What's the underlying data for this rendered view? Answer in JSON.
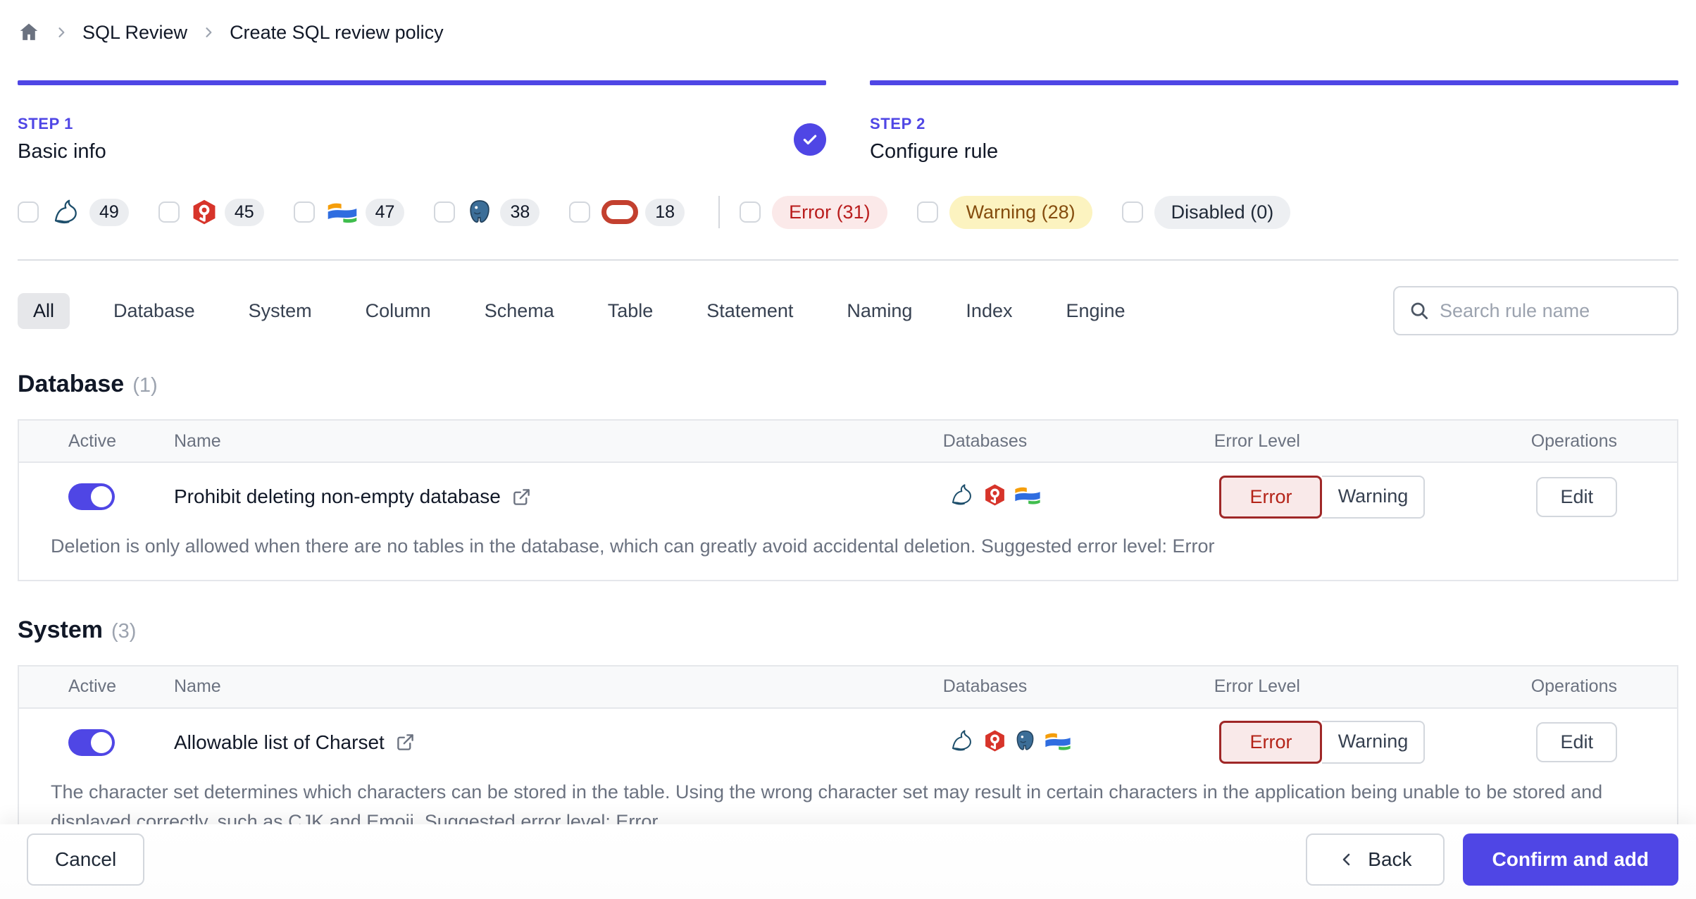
{
  "breadcrumb": {
    "items": [
      "SQL Review",
      "Create SQL review policy"
    ]
  },
  "steps": [
    {
      "label": "STEP 1",
      "title": "Basic info",
      "completed": true
    },
    {
      "label": "STEP 2",
      "title": "Configure rule",
      "completed": false
    }
  ],
  "engine_filters": [
    {
      "engine": "mysql",
      "count": "49",
      "checked": false
    },
    {
      "engine": "tidb",
      "count": "45",
      "checked": false
    },
    {
      "engine": "oceanbase",
      "count": "47",
      "checked": false
    },
    {
      "engine": "postgres",
      "count": "38",
      "checked": false
    },
    {
      "engine": "oracle",
      "count": "18",
      "checked": false
    }
  ],
  "level_filters": [
    {
      "label": "Error (31)",
      "type": "error",
      "checked": false
    },
    {
      "label": "Warning (28)",
      "type": "warning",
      "checked": false
    },
    {
      "label": "Disabled (0)",
      "type": "disabled",
      "checked": false
    }
  ],
  "tabs": {
    "selected": "All",
    "items": [
      "All",
      "Database",
      "System",
      "Column",
      "Schema",
      "Table",
      "Statement",
      "Naming",
      "Index",
      "Engine"
    ]
  },
  "search": {
    "placeholder": "Search rule name"
  },
  "table": {
    "headers": [
      "Active",
      "Name",
      "Databases",
      "Error Level",
      "Operations"
    ]
  },
  "error_level_options": [
    "Error",
    "Warning"
  ],
  "sections": [
    {
      "title": "Database",
      "count": "(1)",
      "rules": [
        {
          "name": "Prohibit deleting non-empty database",
          "active": true,
          "engines": [
            "mysql",
            "tidb",
            "oceanbase"
          ],
          "selected_level": "Error",
          "edit_label": "Edit",
          "description": "Deletion is only allowed when there are no tables in the database, which can greatly avoid accidental deletion. Suggested error level: Error"
        }
      ]
    },
    {
      "title": "System",
      "count": "(3)",
      "rules": [
        {
          "name": "Allowable list of Charset",
          "active": true,
          "engines": [
            "mysql",
            "tidb",
            "postgres",
            "oceanbase"
          ],
          "selected_level": "Error",
          "edit_label": "Edit",
          "description": "The character set determines which characters can be stored in the table. Using the wrong character set may result in certain characters in the application being unable to be stored and displayed correctly, such as CJK and Emoji. Suggested error level: Error"
        }
      ]
    }
  ],
  "footer": {
    "cancel": "Cancel",
    "back": "Back",
    "confirm": "Confirm and add"
  },
  "icons": {
    "home-icon": "house glyph",
    "chevron-right-icon": "breadcrumb separator",
    "check-circle-icon": "step completed",
    "mysql-icon": "MySQL dolphin",
    "tidb-icon": "TiDB red hexagon",
    "oceanbase-icon": "OceanBase wave flag",
    "postgres-icon": "PostgreSQL elephant",
    "oracle-icon": "Oracle red ring",
    "search-icon": "magnifier",
    "external-link-icon": "open docs",
    "chevron-left-icon": "back arrow"
  },
  "colors": {
    "accent": "#4f46e5",
    "error_text": "#b91c1c",
    "error_bg": "#fbe9e9",
    "warning_text": "#854d0e",
    "warning_bg": "#fcf3c0",
    "disabled_bg": "#edeff2",
    "muted_text": "#6b7280",
    "border": "#e5e7eb"
  }
}
